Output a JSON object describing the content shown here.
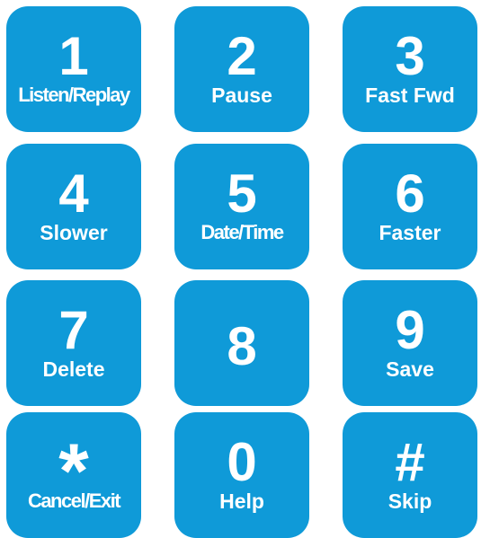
{
  "keypad": {
    "keys": [
      {
        "digit": "1",
        "label": "Listen/Replay"
      },
      {
        "digit": "2",
        "label": "Pause"
      },
      {
        "digit": "3",
        "label": "Fast Fwd"
      },
      {
        "digit": "4",
        "label": "Slower"
      },
      {
        "digit": "5",
        "label": "Date/Time"
      },
      {
        "digit": "6",
        "label": "Faster"
      },
      {
        "digit": "7",
        "label": "Delete"
      },
      {
        "digit": "8",
        "label": ""
      },
      {
        "digit": "9",
        "label": "Save"
      },
      {
        "digit": "*",
        "label": "Cancel/Exit"
      },
      {
        "digit": "0",
        "label": "Help"
      },
      {
        "digit": "#",
        "label": "Skip"
      }
    ],
    "colors": {
      "key_background": "#0f9ad8",
      "key_text": "#ffffff"
    }
  }
}
